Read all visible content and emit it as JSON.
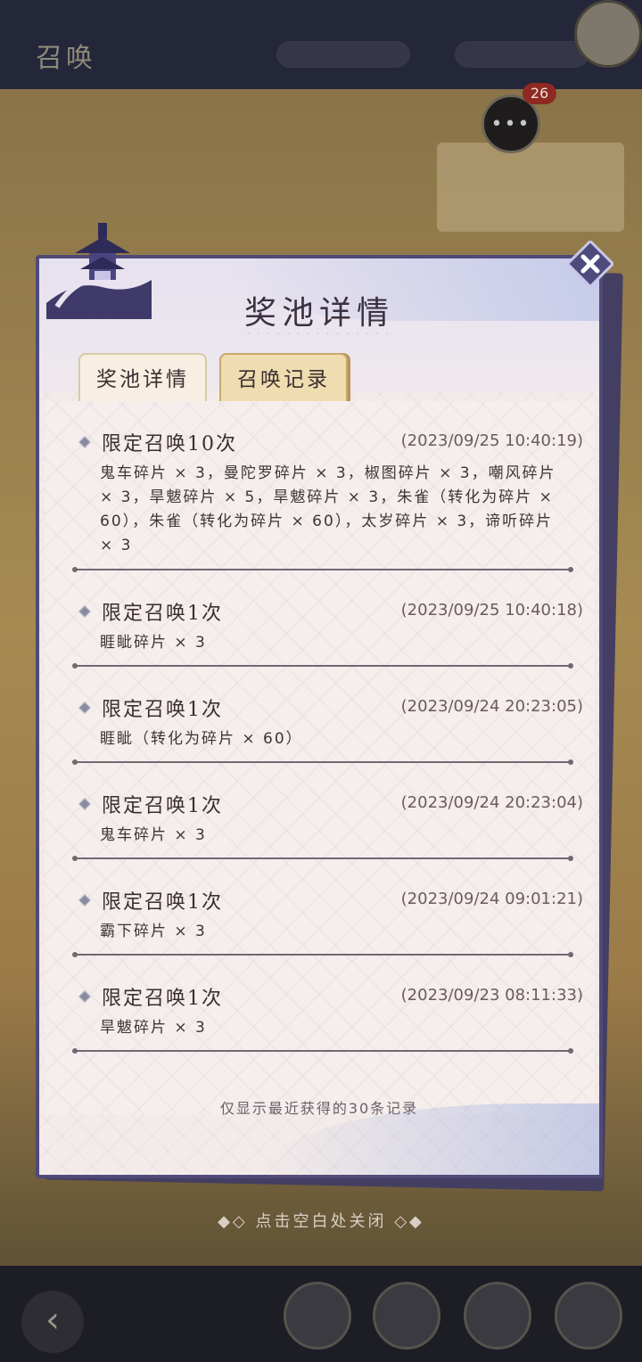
{
  "background": {
    "title": "召唤",
    "chat_badge": "26",
    "chat_icon_text": "•••"
  },
  "modal": {
    "title": "奖池详情",
    "tabs": [
      {
        "label": "奖池详情",
        "active": false
      },
      {
        "label": "召唤记录",
        "active": true
      }
    ],
    "records": [
      {
        "title": "限定召唤10次",
        "time": "(2023/09/25  10:40:19)",
        "body": "鬼车碎片 × 3，曼陀罗碎片 × 3，椒图碎片 × 3，嘲风碎片 × 3，旱魃碎片 × 5，旱魃碎片 × 3，朱雀（转化为碎片 × 60），朱雀（转化为碎片 × 60），太岁碎片 × 3，谛听碎片 × 3"
      },
      {
        "title": "限定召唤1次",
        "time": "(2023/09/25  10:40:18)",
        "body": "睚眦碎片 × 3"
      },
      {
        "title": "限定召唤1次",
        "time": "(2023/09/24  20:23:05)",
        "body": "睚眦（转化为碎片 × 60）"
      },
      {
        "title": "限定召唤1次",
        "time": "(2023/09/24  20:23:04)",
        "body": "鬼车碎片 × 3"
      },
      {
        "title": "限定召唤1次",
        "time": "(2023/09/24  09:01:21)",
        "body": "霸下碎片 × 3"
      },
      {
        "title": "限定召唤1次",
        "time": "(2023/09/23  08:11:33)",
        "body": "旱魃碎片 × 3"
      }
    ],
    "footer_note": "仅显示最近获得的30条记录",
    "close_icon": "close-x-icon"
  },
  "tap_to_close": "◆◇ 点击空白处关闭 ◇◆",
  "colors": {
    "panel_border": "#4f4a78",
    "active_tab": "#efdcb0",
    "text": "#3b2e2e"
  }
}
